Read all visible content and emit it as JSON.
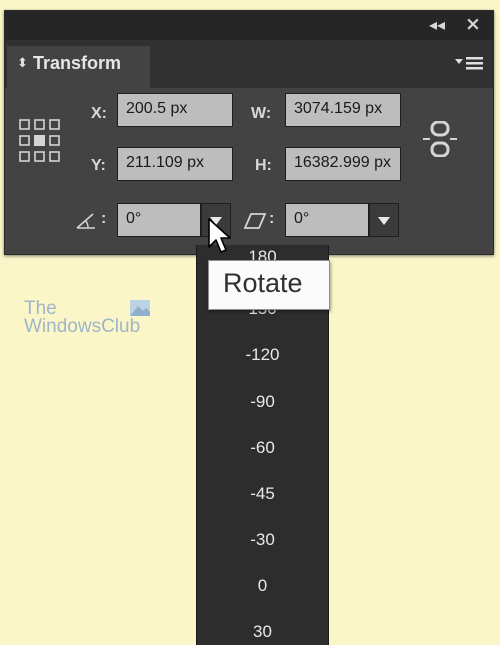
{
  "panel": {
    "title": "Transform",
    "collapse_glyph": "◂◂",
    "close_glyph": "×"
  },
  "fields": {
    "x_label": "X:",
    "x_value": "200.5 px",
    "y_label": "Y:",
    "y_value": "211.109 px",
    "w_label": "W:",
    "w_value": "3074.159 px",
    "h_label": "H:",
    "h_value": "16382.999 px",
    "rotate_value": "0°",
    "shear_value": "0°",
    "label_colon": ":"
  },
  "rotate_dropdown": {
    "options": [
      "180",
      "150",
      "-120",
      "-90",
      "-60",
      "-45",
      "-30",
      "0",
      "30"
    ]
  },
  "tooltip": "Rotate",
  "watermark": {
    "line1": "The",
    "line2": "WindowsClub"
  },
  "colors": {
    "page_bg": "#faf6c8",
    "panel_bg": "#434343",
    "field_bg": "#bdbdbd",
    "dropdown_bg": "#2d2d2d"
  },
  "icons": {
    "reference_point": "reference-point-icon",
    "constrain": "link-icon",
    "rotate": "rotate-angle-icon",
    "shear": "shear-icon",
    "panel_menu": "panel-menu-icon"
  }
}
